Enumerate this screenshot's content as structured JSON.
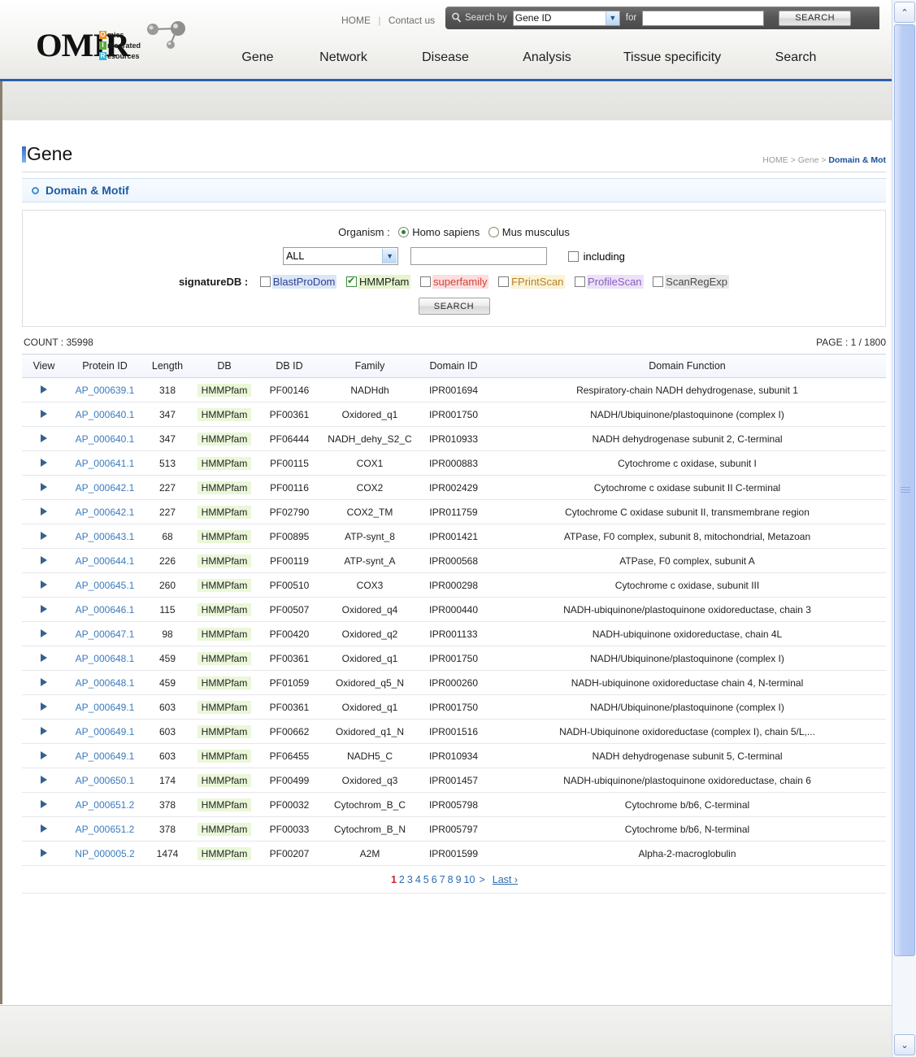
{
  "header": {
    "logo": {
      "main": "OMIR",
      "lines": [
        {
          "letter": "O",
          "rest": "mics"
        },
        {
          "letter": "I",
          "rest": "ntegrated"
        },
        {
          "letter": "R",
          "rest": "esources"
        }
      ]
    },
    "top_links": {
      "home": "HOME",
      "separator": "|",
      "contact": "Contact us"
    },
    "search": {
      "label": "Search by",
      "selected_option": "Gene ID",
      "for_label": "for",
      "query_value": "",
      "button": "SEARCH"
    },
    "nav": [
      {
        "label": "Gene"
      },
      {
        "label": "Network"
      },
      {
        "label": "Disease"
      },
      {
        "label": "Analysis"
      },
      {
        "label": "Tissue specificity"
      },
      {
        "label": "Search"
      }
    ]
  },
  "page": {
    "title": "Gene",
    "breadcrumb": {
      "home": "HOME",
      "sep1": ">",
      "gene": "Gene",
      "sep2": ">",
      "current": "Domain & Mot"
    },
    "section_title": "Domain & Motif"
  },
  "form": {
    "organism_label": "Organism :",
    "organism_options": [
      {
        "label": "Homo sapiens",
        "selected": true
      },
      {
        "label": "Mus musculus",
        "selected": false
      }
    ],
    "field_select_value": "ALL",
    "keyword_value": "",
    "including_label": "including",
    "including_checked": false,
    "signature_label": "signatureDB :",
    "signature_dbs": [
      {
        "label": "BlastProDom",
        "checked": false,
        "color": "#2f3f8f",
        "bg": "#dbe6f7"
      },
      {
        "label": "HMMPfam",
        "checked": true,
        "color": "#1f1f1f",
        "bg": "#e4f5cd"
      },
      {
        "label": "superfamily",
        "checked": false,
        "color": "#d2453b",
        "bg": "#fbdedd"
      },
      {
        "label": "FPrintScan",
        "checked": false,
        "color": "#b5832b",
        "bg": "#fbf3d6"
      },
      {
        "label": "ProfileScan",
        "checked": false,
        "color": "#8a5fbf",
        "bg": "#ece2f7"
      },
      {
        "label": "ScanRegExp",
        "checked": false,
        "color": "#4a4a4a",
        "bg": "#e8e8e8"
      }
    ],
    "search_button": "SEARCH"
  },
  "results": {
    "count_label": "COUNT : 35998",
    "page_label": "PAGE : 1 / 1800",
    "columns": [
      "View",
      "Protein ID",
      "Length",
      "DB",
      "DB ID",
      "Family",
      "Domain ID",
      "Domain Function"
    ],
    "rows": [
      {
        "view": "▶",
        "protein_id": "AP_000639.1",
        "length": "318",
        "db": "HMMPfam",
        "db_id": "PF00146",
        "family": "NADHdh",
        "domain_id": "IPR001694",
        "function": "Respiratory-chain NADH dehydrogenase, subunit 1"
      },
      {
        "view": "▶",
        "protein_id": "AP_000640.1",
        "length": "347",
        "db": "HMMPfam",
        "db_id": "PF00361",
        "family": "Oxidored_q1",
        "domain_id": "IPR001750",
        "function": "NADH/Ubiquinone/plastoquinone (complex I)"
      },
      {
        "view": "▶",
        "protein_id": "AP_000640.1",
        "length": "347",
        "db": "HMMPfam",
        "db_id": "PF06444",
        "family": "NADH_dehy_S2_C",
        "domain_id": "IPR010933",
        "function": "NADH dehydrogenase subunit 2, C-terminal"
      },
      {
        "view": "▶",
        "protein_id": "AP_000641.1",
        "length": "513",
        "db": "HMMPfam",
        "db_id": "PF00115",
        "family": "COX1",
        "domain_id": "IPR000883",
        "function": "Cytochrome c oxidase, subunit I"
      },
      {
        "view": "▶",
        "protein_id": "AP_000642.1",
        "length": "227",
        "db": "HMMPfam",
        "db_id": "PF00116",
        "family": "COX2",
        "domain_id": "IPR002429",
        "function": "Cytochrome c oxidase subunit II C-terminal"
      },
      {
        "view": "▶",
        "protein_id": "AP_000642.1",
        "length": "227",
        "db": "HMMPfam",
        "db_id": "PF02790",
        "family": "COX2_TM",
        "domain_id": "IPR011759",
        "function": "Cytochrome C oxidase subunit II, transmembrane region"
      },
      {
        "view": "▶",
        "protein_id": "AP_000643.1",
        "length": "68",
        "db": "HMMPfam",
        "db_id": "PF00895",
        "family": "ATP-synt_8",
        "domain_id": "IPR001421",
        "function": "ATPase, F0 complex, subunit 8, mitochondrial, Metazoan"
      },
      {
        "view": "▶",
        "protein_id": "AP_000644.1",
        "length": "226",
        "db": "HMMPfam",
        "db_id": "PF00119",
        "family": "ATP-synt_A",
        "domain_id": "IPR000568",
        "function": "ATPase, F0 complex, subunit A"
      },
      {
        "view": "▶",
        "protein_id": "AP_000645.1",
        "length": "260",
        "db": "HMMPfam",
        "db_id": "PF00510",
        "family": "COX3",
        "domain_id": "IPR000298",
        "function": "Cytochrome c oxidase, subunit III"
      },
      {
        "view": "▶",
        "protein_id": "AP_000646.1",
        "length": "115",
        "db": "HMMPfam",
        "db_id": "PF00507",
        "family": "Oxidored_q4",
        "domain_id": "IPR000440",
        "function": "NADH-ubiquinone/plastoquinone oxidoreductase, chain 3"
      },
      {
        "view": "▶",
        "protein_id": "AP_000647.1",
        "length": "98",
        "db": "HMMPfam",
        "db_id": "PF00420",
        "family": "Oxidored_q2",
        "domain_id": "IPR001133",
        "function": "NADH-ubiquinone oxidoreductase, chain 4L"
      },
      {
        "view": "▶",
        "protein_id": "AP_000648.1",
        "length": "459",
        "db": "HMMPfam",
        "db_id": "PF00361",
        "family": "Oxidored_q1",
        "domain_id": "IPR001750",
        "function": "NADH/Ubiquinone/plastoquinone (complex I)"
      },
      {
        "view": "▶",
        "protein_id": "AP_000648.1",
        "length": "459",
        "db": "HMMPfam",
        "db_id": "PF01059",
        "family": "Oxidored_q5_N",
        "domain_id": "IPR000260",
        "function": "NADH-ubiquinone oxidoreductase chain 4, N-terminal"
      },
      {
        "view": "▶",
        "protein_id": "AP_000649.1",
        "length": "603",
        "db": "HMMPfam",
        "db_id": "PF00361",
        "family": "Oxidored_q1",
        "domain_id": "IPR001750",
        "function": "NADH/Ubiquinone/plastoquinone (complex I)"
      },
      {
        "view": "▶",
        "protein_id": "AP_000649.1",
        "length": "603",
        "db": "HMMPfam",
        "db_id": "PF00662",
        "family": "Oxidored_q1_N",
        "domain_id": "IPR001516",
        "function": "NADH-Ubiquinone oxidoreductase (complex I), chain 5/L,..."
      },
      {
        "view": "▶",
        "protein_id": "AP_000649.1",
        "length": "603",
        "db": "HMMPfam",
        "db_id": "PF06455",
        "family": "NADH5_C",
        "domain_id": "IPR010934",
        "function": "NADH dehydrogenase subunit 5, C-terminal"
      },
      {
        "view": "▶",
        "protein_id": "AP_000650.1",
        "length": "174",
        "db": "HMMPfam",
        "db_id": "PF00499",
        "family": "Oxidored_q3",
        "domain_id": "IPR001457",
        "function": "NADH-ubiquinone/plastoquinone oxidoreductase, chain 6"
      },
      {
        "view": "▶",
        "protein_id": "AP_000651.2",
        "length": "378",
        "db": "HMMPfam",
        "db_id": "PF00032",
        "family": "Cytochrom_B_C",
        "domain_id": "IPR005798",
        "function": "Cytochrome b/b6, C-terminal"
      },
      {
        "view": "▶",
        "protein_id": "AP_000651.2",
        "length": "378",
        "db": "HMMPfam",
        "db_id": "PF00033",
        "family": "Cytochrom_B_N",
        "domain_id": "IPR005797",
        "function": "Cytochrome b/b6, N-terminal"
      },
      {
        "view": "▶",
        "protein_id": "NP_000005.2",
        "length": "1474",
        "db": "HMMPfam",
        "db_id": "PF00207",
        "family": "A2M",
        "domain_id": "IPR001599",
        "function": "Alpha-2-macroglobulin"
      }
    ],
    "pagination": {
      "pages": [
        "1",
        "2",
        "3",
        "4",
        "5",
        "6",
        "7",
        "8",
        "9",
        "10"
      ],
      "current": "1",
      "next_symbol": ">",
      "last_label": "Last ›"
    }
  },
  "scrollbar": {
    "up": "⌃",
    "down": "⌄"
  },
  "theme": {
    "accent": "#2b5fa8",
    "link": "#3a7bbf",
    "current_page": "#d1202b"
  }
}
